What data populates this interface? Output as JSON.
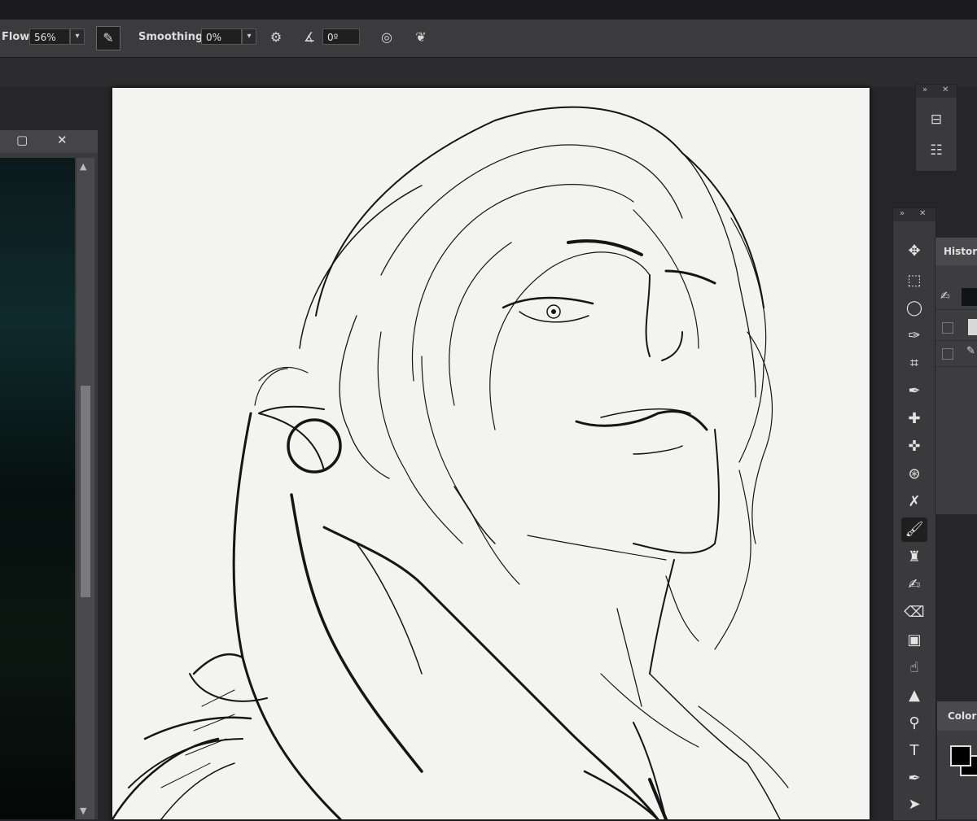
{
  "options_bar": {
    "flow_label": "Flow:",
    "flow_value": "56%",
    "smoothing_label": "Smoothing:",
    "smoothing_value": "0%",
    "angle_value": "0º"
  },
  "panels": {
    "history_title": "History",
    "color_title": "Color"
  },
  "icons": {
    "airbrush": "airbrush-icon",
    "settings": "gear-icon",
    "angle": "angle-icon",
    "pressure": "pressure-icon",
    "symmetry": "butterfly-icon"
  },
  "colors": {
    "foreground": "#000000",
    "background": "#000000"
  }
}
